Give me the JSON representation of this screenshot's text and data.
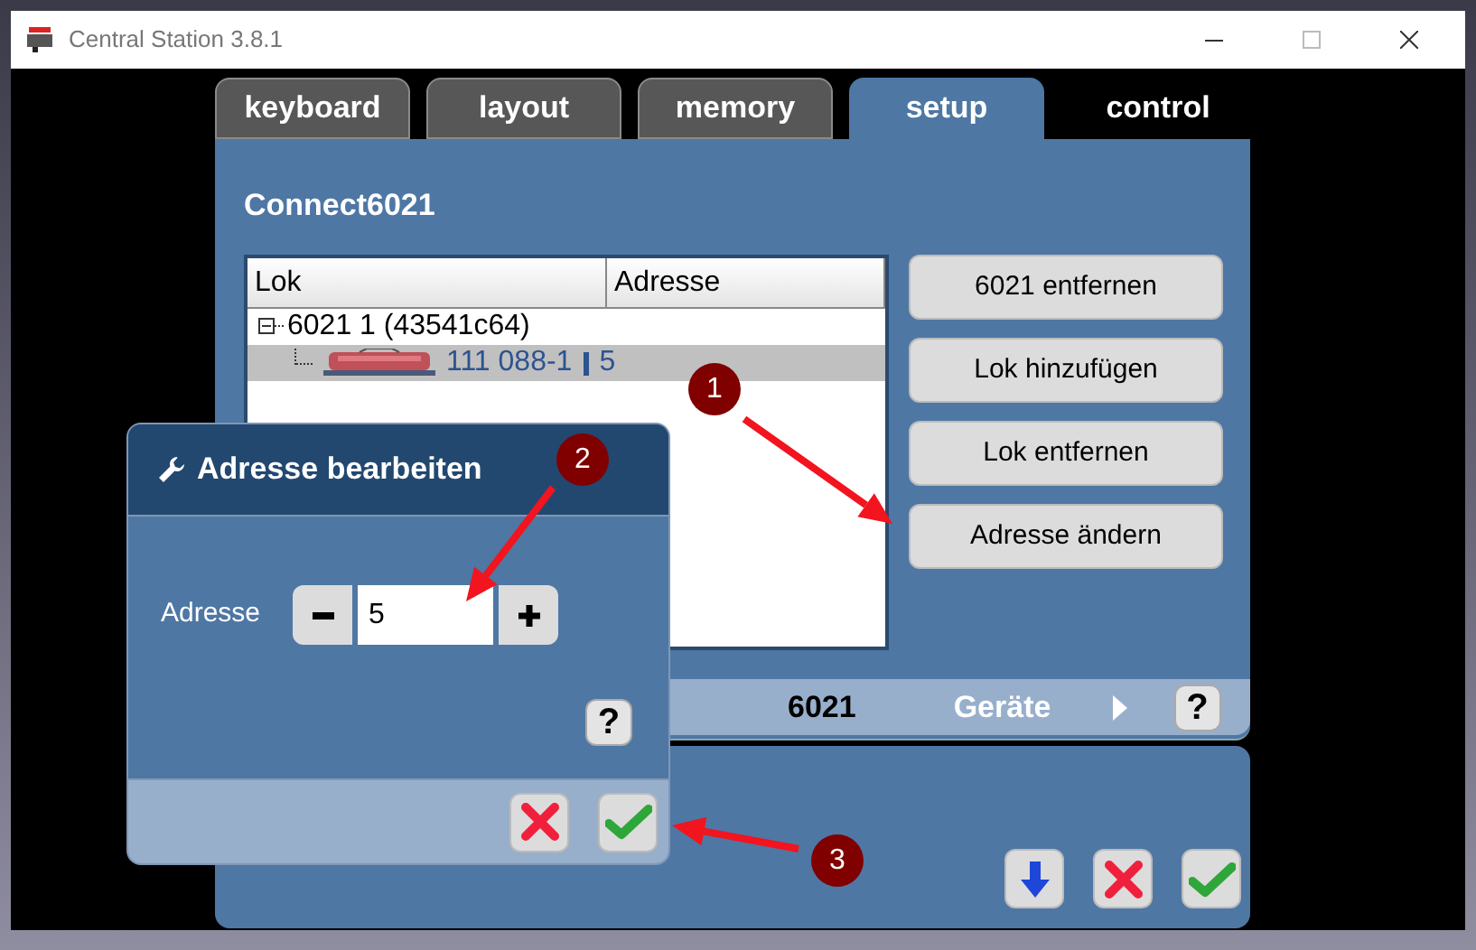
{
  "window": {
    "title": "Central Station 3.8.1"
  },
  "tabs": [
    {
      "label": "keyboard",
      "selected": false,
      "kind": "tab"
    },
    {
      "label": "layout",
      "selected": false,
      "kind": "tab"
    },
    {
      "label": "memory",
      "selected": false,
      "kind": "tab"
    },
    {
      "label": "setup",
      "selected": true,
      "kind": "tab"
    },
    {
      "label": "control",
      "selected": false,
      "kind": "plain"
    }
  ],
  "panel": {
    "title": "Connect6021",
    "table": {
      "columns": [
        "Lok",
        "Adresse"
      ],
      "tree": [
        {
          "label": "6021 1 (43541c64)",
          "expanded": true,
          "children": [
            {
              "name": "111 088-1",
              "address": "5",
              "selected": true
            }
          ]
        }
      ]
    },
    "actions": [
      "6021 entfernen",
      "Lok hinzufügen",
      "Lok entfernen",
      "Adresse ändern"
    ],
    "footer": {
      "device": "6021",
      "nav_label": "Geräte",
      "help": "?"
    }
  },
  "bottom_buttons": [
    {
      "kind": "down"
    },
    {
      "kind": "cancel"
    },
    {
      "kind": "ok"
    }
  ],
  "dialog": {
    "title": "Adresse bearbeiten",
    "field_label": "Adresse",
    "value": "5",
    "help": "?",
    "buttons": [
      {
        "kind": "cancel"
      },
      {
        "kind": "ok"
      }
    ]
  },
  "annotations": [
    {
      "number": "1"
    },
    {
      "number": "2"
    },
    {
      "number": "3"
    }
  ]
}
